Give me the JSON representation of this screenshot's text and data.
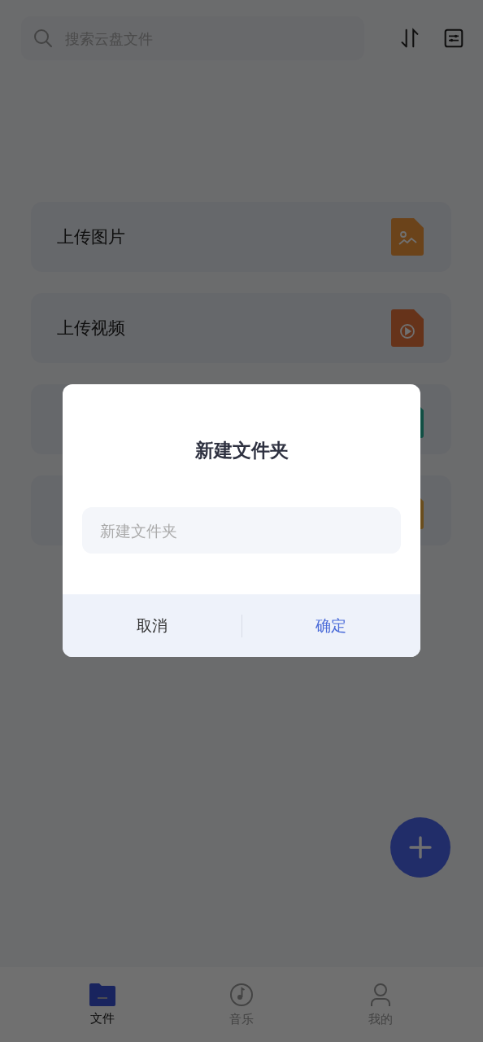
{
  "search": {
    "placeholder": "搜索云盘文件"
  },
  "actions": [
    {
      "kind": "image",
      "label": "上传图片"
    },
    {
      "kind": "video",
      "label": "上传视频"
    },
    {
      "kind": "doc"
    },
    {
      "kind": "folder"
    }
  ],
  "dialog": {
    "title": "新建文件夹",
    "placeholder": "新建文件夹",
    "buttons": [
      {
        "kind": "cancel",
        "label": "取消"
      },
      {
        "kind": "confirm",
        "label": "确定"
      }
    ]
  },
  "nav": [
    {
      "kind": "files",
      "label": "文件",
      "selected": true
    },
    {
      "kind": "music",
      "label": "音乐",
      "selected": false
    },
    {
      "kind": "me",
      "label": "我的",
      "selected": false
    }
  ]
}
